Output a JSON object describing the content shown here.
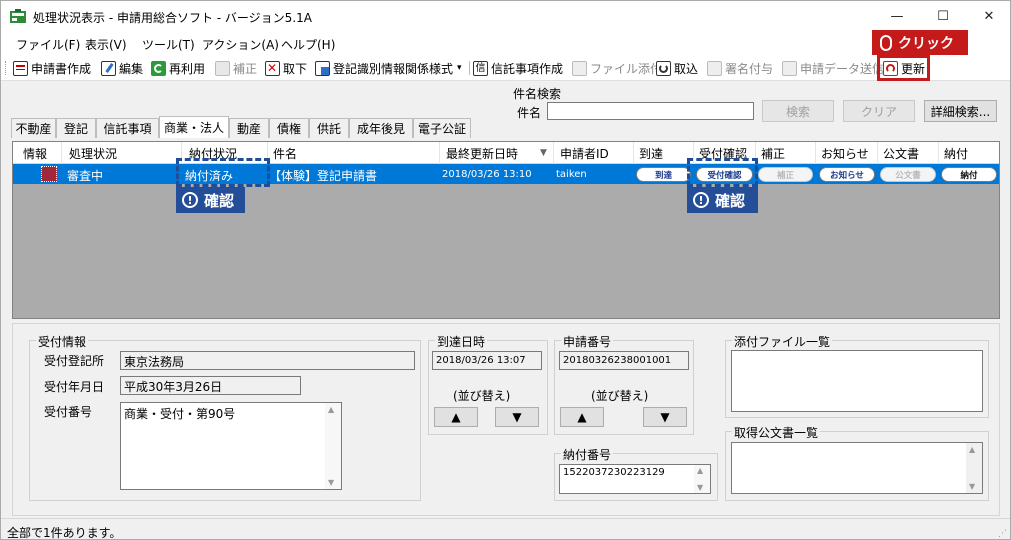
{
  "window": {
    "title": "処理状況表示 - 申請用総合ソフト - バージョン5.1A",
    "minimize_glyph": "—",
    "maximize_glyph": "☐",
    "close_glyph": "✕"
  },
  "menu": [
    {
      "label": "ファイル(F)"
    },
    {
      "label": "表示(V)"
    },
    {
      "label": "ツール(T)"
    },
    {
      "label": "アクション(A)"
    },
    {
      "label": "ヘルプ(H)"
    }
  ],
  "toolbar": {
    "items": [
      {
        "label": "申請書作成",
        "icon": "form-icon",
        "enabled": true
      },
      {
        "label": "編集",
        "icon": "edit-icon",
        "enabled": true
      },
      {
        "label": "再利用",
        "icon": "reuse-icon",
        "enabled": true
      },
      {
        "label": "補正",
        "icon": "correct-icon",
        "enabled": false
      },
      {
        "label": "取下",
        "icon": "withdraw-icon",
        "enabled": true
      },
      {
        "label": "登記識別情報関係様式",
        "icon": "registry-form-icon",
        "enabled": true
      },
      {
        "label": "信託事項作成",
        "icon": "trust-icon",
        "enabled": true
      },
      {
        "label": "ファイル添付",
        "icon": "attach-icon",
        "enabled": false
      },
      {
        "label": "取込",
        "icon": "import-icon",
        "enabled": true
      },
      {
        "label": "署名付与",
        "icon": "sign-icon",
        "enabled": false
      },
      {
        "label": "申請データ送信",
        "icon": "send-icon",
        "enabled": false
      },
      {
        "label": "更新",
        "icon": "refresh-icon",
        "enabled": true
      }
    ],
    "dropdown_glyph": "▾"
  },
  "annotation": {
    "click_label": "クリック",
    "confirm_label": "確認",
    "confirm_symbol": "!"
  },
  "search": {
    "group_label": "件名検索",
    "field_label": "件名",
    "value": "",
    "search_button": "検索",
    "clear_button": "クリア",
    "detail_button": "詳細検索..."
  },
  "tabs": [
    {
      "label": "不動産",
      "active": false
    },
    {
      "label": "登記",
      "active": false
    },
    {
      "label": "信託事項",
      "active": false
    },
    {
      "label": "商業・法人",
      "active": true
    },
    {
      "label": "動産",
      "active": false
    },
    {
      "label": "債権",
      "active": false
    },
    {
      "label": "供託",
      "active": false
    },
    {
      "label": "成年後見",
      "active": false
    },
    {
      "label": "電子公証",
      "active": false
    }
  ],
  "list": {
    "columns": [
      "情報",
      "処理状況",
      "納付状況",
      "件名",
      "最終更新日時",
      "申請者ID",
      "到達",
      "受付確認",
      "補正",
      "お知らせ",
      "公文書",
      "納付"
    ],
    "sort_glyph": "▼",
    "rows": [
      {
        "status": "審査中",
        "payment_status": "納付済み",
        "subject": "【体験】登記申請書",
        "updated": "2018/03/26 13:10",
        "applicant_id": "taiken",
        "arrival": "到達",
        "receipt_confirm": "受付確認",
        "correction": "補正",
        "notice": "お知らせ",
        "official_doc": "公文書",
        "payment": "納付"
      }
    ]
  },
  "detail": {
    "receipt": {
      "group_label": "受付情報",
      "office_label": "受付登記所",
      "office_value": "東京法務局",
      "date_label": "受付年月日",
      "date_value": "平成30年3月26日",
      "number_label": "受付番号",
      "number_value": "商業・受付・第90号"
    },
    "arrival": {
      "group_label": "到達日時",
      "value": "2018/03/26 13:07",
      "sort_label": "(並び替え)",
      "up_glyph": "▲",
      "down_glyph": "▼"
    },
    "application_number": {
      "group_label": "申請番号",
      "value": "20180326238001001",
      "sort_label": "(並び替え)",
      "up_glyph": "▲",
      "down_glyph": "▼"
    },
    "payment_number": {
      "group_label": "納付番号",
      "value": "1522037230223129"
    },
    "attachments": {
      "group_label": "添付ファイル一覧"
    },
    "obtained_docs": {
      "group_label": "取得公文書一覧"
    }
  },
  "statusbar": {
    "text": "全部で1件あります。"
  }
}
